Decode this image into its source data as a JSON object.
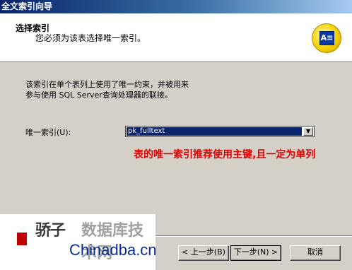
{
  "window": {
    "title": "全文索引向导"
  },
  "header": {
    "title": "选择索引",
    "subtitle": "您必须为该表选择唯一索引。",
    "icon": "wizard-index-icon"
  },
  "description": {
    "line1": "该索引在单个表列上使用了唯一约束，并被用来",
    "line2": "参与使用 SQL Server查询处理器的联接。"
  },
  "unique_index": {
    "label": "唯一索引(U):",
    "value": "pk_fulltext"
  },
  "annotation": {
    "text": "表的唯一索引推荐使用主键,且一定为单列",
    "color": "#e00000"
  },
  "watermark": {
    "brand_cn": "骄子",
    "brand_site": "数据库技术网",
    "brand_domain": "Chinadba.cn"
  },
  "buttons": {
    "back": "< 上一步(B)",
    "next": "下一步(N) >",
    "cancel": "取消"
  },
  "colors": {
    "accent": "#0a246a",
    "dialog_bg": "#d4d0c8"
  }
}
